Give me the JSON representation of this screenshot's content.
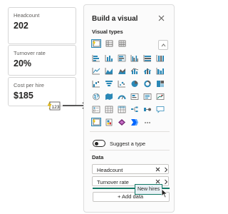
{
  "cards": [
    {
      "label": "Headcount",
      "value": "202"
    },
    {
      "label": "Turnover rate",
      "value": "20%"
    },
    {
      "label": "Cost per hire",
      "value": "$185"
    }
  ],
  "callout": {
    "icon": "card-visual-icon",
    "number": "123"
  },
  "pane": {
    "title": "Build a visual",
    "close_icon": "close-icon",
    "visual_types_title": "Visual types",
    "visual_types": [
      "card",
      "table",
      "matrix",
      "stacked-bar",
      "clustered-bar",
      "stacked-column",
      "clustered-column",
      "100-stacked-bar",
      "100-stacked-column",
      "line",
      "area",
      "stacked-area",
      "line-clustered-column",
      "line-stacked-column",
      "ribbon",
      "waterfall",
      "funnel",
      "scatter",
      "pie",
      "donut",
      "treemap",
      "map",
      "filled-map",
      "gauge",
      "card-new",
      "multi-row-card",
      "kpi",
      "slicer",
      "table-visual",
      "matrix-visual",
      "decomposition-tree",
      "key-influencers",
      "qa",
      "card-selected",
      "paginated-report",
      "power-apps",
      "power-automate",
      "more"
    ],
    "suggest_label": "Suggest a type",
    "data_title": "Data",
    "fields": [
      {
        "name": "Headcount"
      },
      {
        "name": "Turnover rate"
      }
    ],
    "add_data_label": "+ Add data",
    "drag_tooltip": "New hires"
  },
  "colors": {
    "accent": "#117865",
    "selected": "#2b88b6",
    "card_yellow": "#f2c811"
  }
}
